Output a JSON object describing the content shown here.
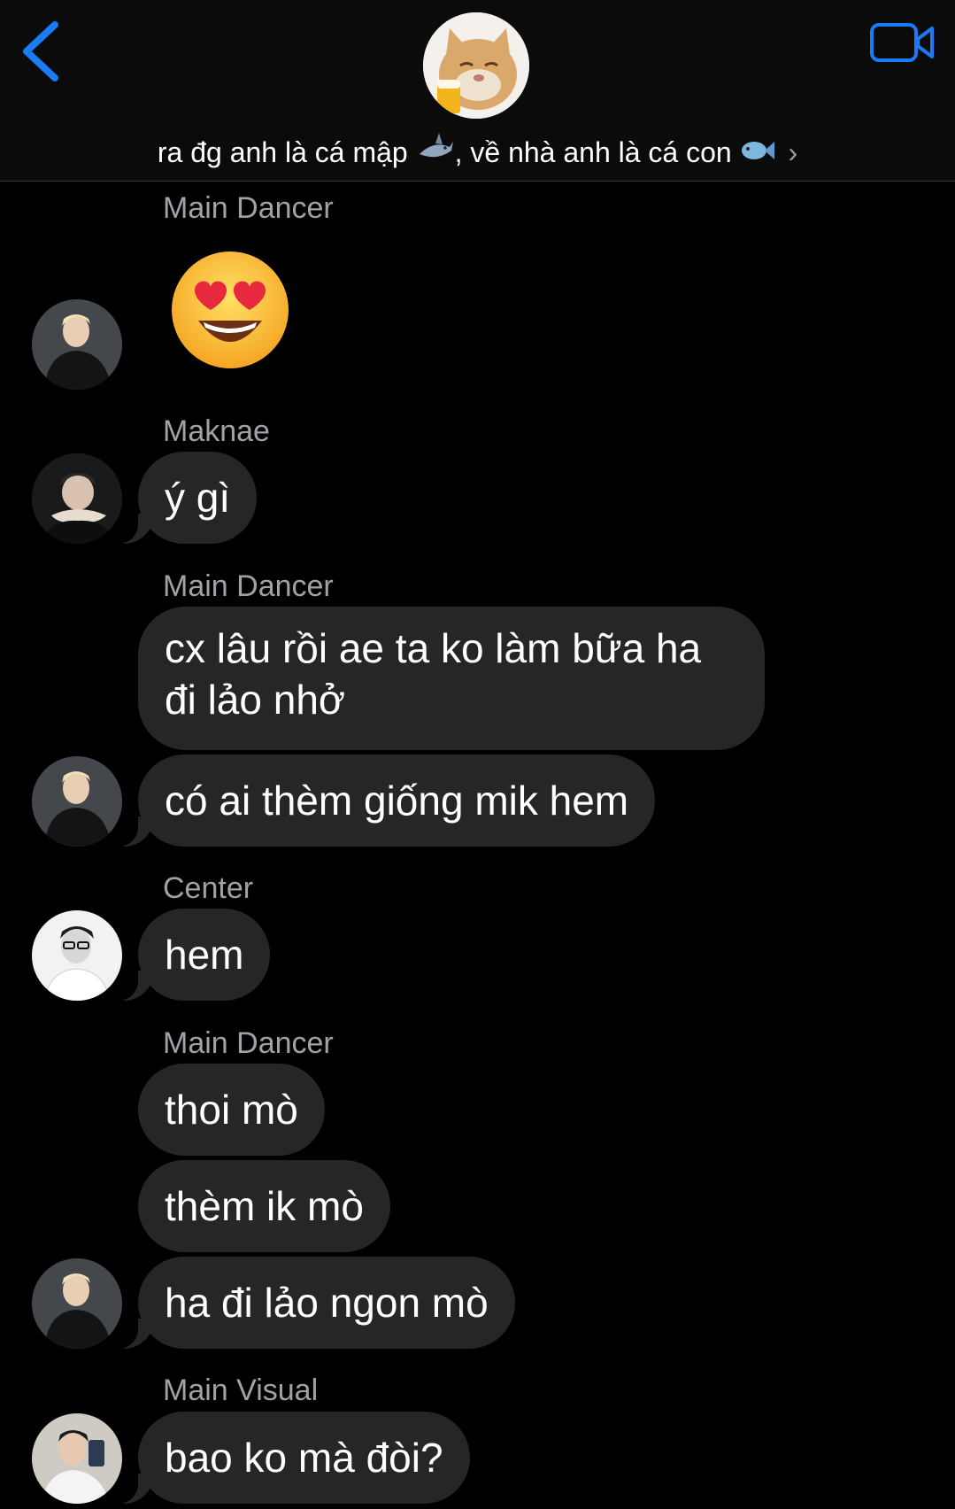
{
  "header": {
    "group_name_text": "ra đg anh là cá mập",
    "group_name_text2": ", về nhà anh là cá con",
    "chevron": "›",
    "back_icon": "chevron-left-icon",
    "video_icon": "video-camera-icon",
    "accent_color": "#1a7cf5"
  },
  "messages": [
    {
      "sender": "Main Dancer",
      "emoji": "😍"
    },
    {
      "sender": "Maknae",
      "text": "ý gì"
    },
    {
      "sender": "Main Dancer",
      "texts": [
        "cx lâu rồi ae ta ko làm bữa ha đi lảo nhở",
        "có ai thèm giống mik hem"
      ]
    },
    {
      "sender": "Center",
      "text": "hem"
    },
    {
      "sender": "Main Dancer",
      "texts": [
        "thoi mò",
        "thèm ik mò",
        "ha đi lảo ngon mò"
      ]
    },
    {
      "sender": "Main Visual",
      "text": "bao ko mà đòi?"
    }
  ]
}
